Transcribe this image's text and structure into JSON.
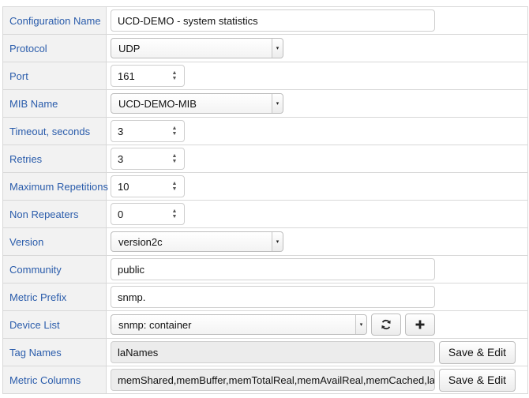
{
  "form": {
    "configuration_name": {
      "label": "Configuration Name",
      "value": "UCD-DEMO - system statistics"
    },
    "protocol": {
      "label": "Protocol",
      "value": "UDP"
    },
    "port": {
      "label": "Port",
      "value": "161"
    },
    "mib_name": {
      "label": "MIB Name",
      "value": "UCD-DEMO-MIB"
    },
    "timeout": {
      "label": "Timeout, seconds",
      "value": "3"
    },
    "retries": {
      "label": "Retries",
      "value": "3"
    },
    "max_repetitions": {
      "label": "Maximum Repetitions",
      "value": "10"
    },
    "non_repeaters": {
      "label": "Non Repeaters",
      "value": "0"
    },
    "version": {
      "label": "Version",
      "value": "version2c"
    },
    "community": {
      "label": "Community",
      "value": "public"
    },
    "metric_prefix": {
      "label": "Metric Prefix",
      "value": "snmp."
    },
    "device_list": {
      "label": "Device List",
      "value": "snmp: container"
    },
    "tag_names": {
      "label": "Tag Names",
      "value": "laNames",
      "button": "Save & Edit"
    },
    "metric_columns": {
      "label": "Metric Columns",
      "value": "memShared,memBuffer,memTotalReal,memAvailReal,memCached,laLoad,",
      "button": "Save & Edit"
    }
  },
  "icons": {
    "refresh": "refresh-icon",
    "add": "plus-icon",
    "dropdown": "chevron-down-icon",
    "spinner": "spinner-arrows-icon"
  },
  "colors": {
    "label_text": "#2a5cab",
    "label_background": "#f2f2f2",
    "border": "#d8d8d8",
    "readonly_background": "#ececec"
  }
}
